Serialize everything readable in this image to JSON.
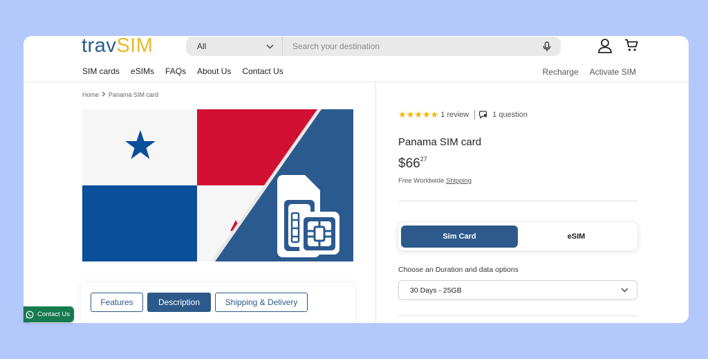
{
  "header": {
    "logo_part1": "trav",
    "logo_part2": "SIM",
    "search": {
      "category": "All",
      "placeholder": "Search your destination"
    }
  },
  "nav": {
    "items": [
      {
        "label": "SIM cards"
      },
      {
        "label": "eSIMs"
      },
      {
        "label": "FAQs"
      },
      {
        "label": "About Us"
      },
      {
        "label": "Contact Us"
      }
    ],
    "right": [
      {
        "label": "Recharge"
      },
      {
        "label": "Activate SIM"
      }
    ]
  },
  "breadcrumb": {
    "home": "Home",
    "current": "Panama SIM card"
  },
  "tabs": [
    {
      "label": "Features"
    },
    {
      "label": "Description"
    },
    {
      "label": "Shipping & Delivery"
    }
  ],
  "product": {
    "reviews": "1 review",
    "questions": "1 question",
    "rating": 5,
    "title": "Panama SIM card",
    "price_main": "$66",
    "price_cents": "27",
    "shipping_prefix": "Free Worldwide ",
    "shipping_link": "Shipping",
    "type_options": [
      "Sim Card",
      "eSIM"
    ],
    "duration_label": "Choose an Duration and data options",
    "duration_value": "30 Days - 25GB"
  },
  "contact_button": "Contact Us",
  "colors": {
    "brand_blue": "#2d5a8a",
    "brand_yellow": "#e9b92b",
    "panama_red": "#d21034",
    "panama_blue": "#0a4f9a",
    "whatsapp_green": "#157a50"
  }
}
